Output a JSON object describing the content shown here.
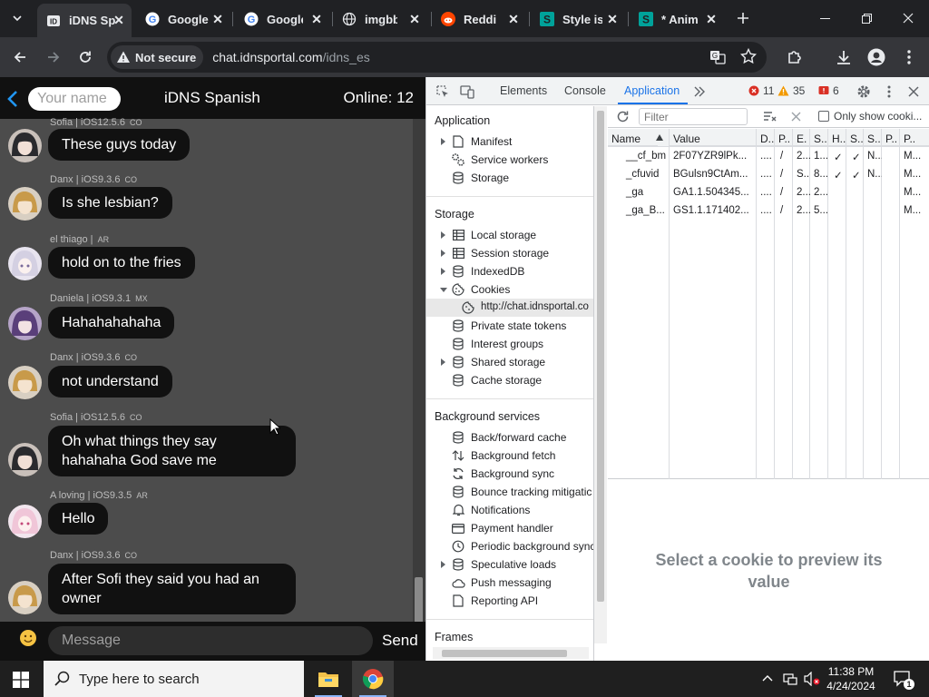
{
  "browser": {
    "tabs": [
      {
        "title": "iDNS Spanish",
        "short": "iDNS Sp",
        "favicon": "idns-favicon",
        "active": true
      },
      {
        "title": "Google",
        "short": "Google",
        "favicon": "google-favicon"
      },
      {
        "title": "Google",
        "short": "Google",
        "favicon": "google-favicon"
      },
      {
        "title": "imgbb",
        "short": "imgbb",
        "favicon": "imgbb-favicon"
      },
      {
        "title": "Reddit",
        "short": "Reddit",
        "favicon": "reddit-favicon"
      },
      {
        "title": "Style is",
        "short": "Style is",
        "favicon": "stylus-favicon"
      },
      {
        "title": "* Anim",
        "short": "* Anim",
        "favicon": "stylus-favicon"
      }
    ],
    "security_chip": "Not secure",
    "url_host": "chat.idnsportal.com",
    "url_path": "/idns_es"
  },
  "chat": {
    "name_placeholder": "Your name",
    "room_title": "iDNS Spanish",
    "online": "Online: 12",
    "messages": [
      {
        "meta": "Sofia | iOS12.5.6",
        "cc": "CO",
        "text": "These guys today",
        "avatar": "dark-hair"
      },
      {
        "meta": "Danx | iOS9.3.6",
        "cc": "CO",
        "text": "Is she lesbian?",
        "avatar": "blonde"
      },
      {
        "meta": "el thiago |",
        "cc": "AR",
        "text": "hold on to the fries",
        "avatar": "white-hair"
      },
      {
        "meta": "Daniela | iOS9.3.1",
        "cc": "MX",
        "text": "Hahahahahaha",
        "avatar": "purple-hair"
      },
      {
        "meta": "Danx | iOS9.3.6",
        "cc": "CO",
        "text": "not understand",
        "avatar": "blonde"
      },
      {
        "meta": "Sofia | iOS12.5.6",
        "cc": "CO",
        "text": "Oh what things they say hahahaha God save me",
        "avatar": "dark-hair"
      },
      {
        "meta": "A loving | iOS9.3.5",
        "cc": "AR",
        "text": "Hello",
        "avatar": "pink-hair"
      },
      {
        "meta": "Danx | iOS9.3.6",
        "cc": "CO",
        "text": "After Sofi they said you had an owner",
        "avatar": "blonde"
      }
    ],
    "message_placeholder": "Message",
    "send_label": "Send"
  },
  "devtools": {
    "tabs": [
      "Elements",
      "Console",
      "Application"
    ],
    "active_tab": "Application",
    "errors": "11",
    "warnings": "35",
    "issues": "6",
    "sidebar": {
      "application_header": "Application",
      "application_items": [
        "Manifest",
        "Service workers",
        "Storage"
      ],
      "storage_header": "Storage",
      "storage_items": [
        "Local storage",
        "Session storage",
        "IndexedDB",
        "Cookies",
        "http://chat.idnsportal.co",
        "Private state tokens",
        "Interest groups",
        "Shared storage",
        "Cache storage"
      ],
      "background_header": "Background services",
      "background_items": [
        "Back/forward cache",
        "Background fetch",
        "Background sync",
        "Bounce tracking mitigatic",
        "Notifications",
        "Payment handler",
        "Periodic background sync",
        "Speculative loads",
        "Push messaging",
        "Reporting API"
      ],
      "frames_header": "Frames"
    },
    "cookies": {
      "filter_placeholder": "Filter",
      "only_show_label": "Only show cooki...",
      "columns": [
        "Name",
        "Value",
        "D..",
        "P..",
        "E.",
        "S..",
        "H..",
        "S..",
        "S..",
        "P..",
        "P.."
      ],
      "rows": [
        [
          "__cf_bm",
          "2F07YZR9lPk...",
          "....",
          "/",
          "2...",
          "1...",
          "✓",
          "✓",
          "N...",
          "",
          "M..."
        ],
        [
          "_cfuvid",
          "BGulsn9CtAm...",
          "....",
          "/",
          "S...",
          "8...",
          "✓",
          "✓",
          "N...",
          "",
          "M..."
        ],
        [
          "_ga",
          "GA1.1.504345...",
          "....",
          "/",
          "2...",
          "2...",
          "",
          "",
          "",
          "",
          "M..."
        ],
        [
          "_ga_B...",
          "GS1.1.171402...",
          "....",
          "/",
          "2...",
          "5...",
          "",
          "",
          "",
          "",
          "M..."
        ]
      ],
      "preview_text": "Select a cookie to preview its value"
    }
  },
  "taskbar": {
    "search_placeholder": "Type here to search",
    "time": "11:38 PM",
    "date": "4/24/2024",
    "notifications": "1"
  }
}
